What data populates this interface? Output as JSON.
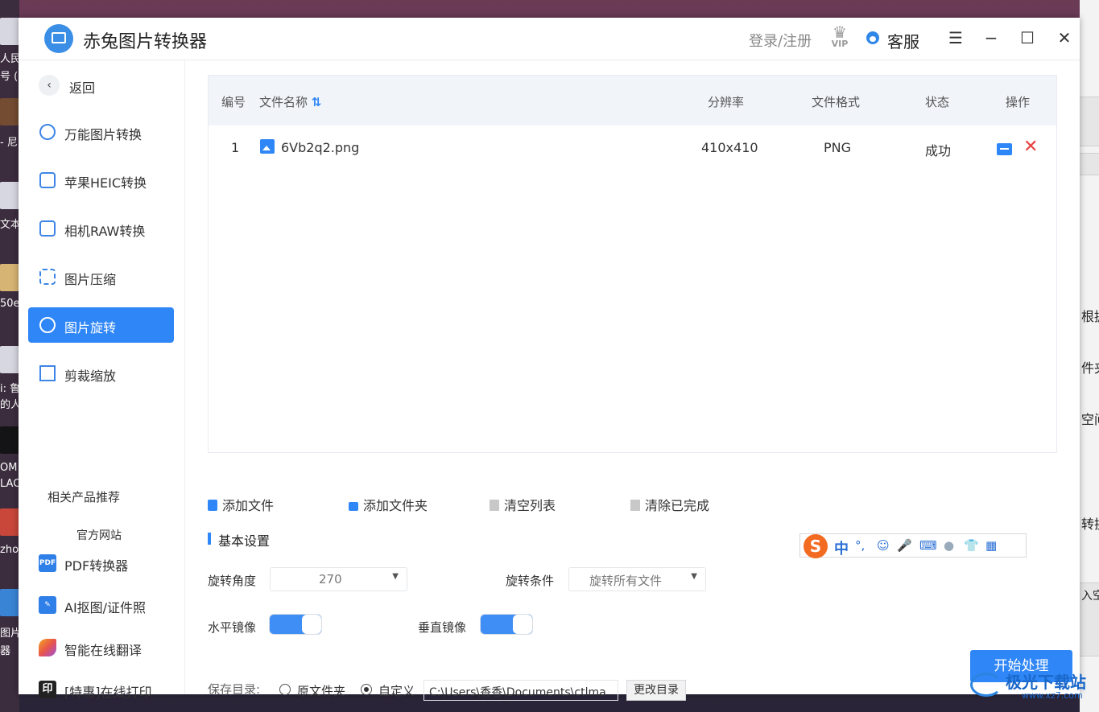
{
  "app": {
    "title": "赤兔图片转换器",
    "login": "登录/注册",
    "vip_badge": "VIP",
    "customer_service": "客服",
    "menu_icon": "menu-icon",
    "min_icon": "minimize-icon",
    "max_icon": "maximize-icon",
    "close_icon": "close-icon"
  },
  "sidebar": {
    "back": "返回",
    "items": [
      {
        "label": "万能图片转换",
        "icon": "image-convert-icon",
        "active": false
      },
      {
        "label": "苹果HEIC转换",
        "icon": "heic-icon",
        "active": false
      },
      {
        "label": "相机RAW转换",
        "icon": "raw-icon",
        "active": false
      },
      {
        "label": "图片压缩",
        "icon": "compress-icon",
        "active": false
      },
      {
        "label": "图片旋转",
        "icon": "rotate-icon",
        "active": true
      },
      {
        "label": "剪裁缩放",
        "icon": "crop-icon",
        "active": false
      }
    ],
    "related_title": "相关产品推荐",
    "official_site": "官方网站",
    "products": [
      {
        "label": "PDF转换器",
        "icon_text": "PDF",
        "color": "#2f7fe8"
      },
      {
        "label": "AI抠图/证件照",
        "icon_text": "✎",
        "color": "#2f7fe8"
      },
      {
        "label": "智能在线翻译",
        "icon_text": "",
        "color": "#e8544a"
      },
      {
        "label": "[特惠]在线打印",
        "icon_text": "印",
        "color": "#222222"
      }
    ]
  },
  "table": {
    "headers": {
      "index": "编号",
      "name": "文件名称",
      "sort_icon": "⇅",
      "resolution": "分辨率",
      "format": "文件格式",
      "status": "状态",
      "action": "操作"
    },
    "rows": [
      {
        "index": "1",
        "name": "6Vb2q2.png",
        "resolution": "410x410",
        "format": "PNG",
        "status": "成功"
      }
    ]
  },
  "actions": {
    "add_file": "添加文件",
    "add_folder": "添加文件夹",
    "clear_list": "清空列表",
    "clear_done": "清除已完成"
  },
  "settings": {
    "section_title": "基本设置",
    "rotate_angle_label": "旋转角度",
    "rotate_angle_value": "270",
    "rotate_condition_label": "旋转条件",
    "rotate_condition_value": "旋转所有文件",
    "h_mirror_label": "水平镜像",
    "h_mirror_on": true,
    "v_mirror_label": "垂直镜像",
    "v_mirror_on": true
  },
  "save": {
    "label": "保存目录:",
    "option_original": "原文件夹",
    "option_custom": "自定义",
    "selected": "custom",
    "path": "C:\\Users\\香香\\Documents\\ctlma",
    "change_dir": "更改目录"
  },
  "start_button": "开始处理",
  "ime": {
    "logo": "S",
    "mode": "中",
    "punct": "°,",
    "emoji": "☺",
    "mic": "🎤",
    "keyboard": "⌨",
    "skin": "👕",
    "apps": "▦"
  },
  "watermark": {
    "text": "极光下载站",
    "url": "www.xz7.com"
  },
  "desktop": {
    "left_texts": [
      "人民",
      "号 (扌",
      "- 尼",
      "文本",
      "50e",
      "i: 鲁",
      "的人",
      "OM",
      "LAC",
      "zho",
      "图片",
      "器"
    ],
    "right_texts": [
      "根据",
      "件夹",
      "空间",
      "转换",
      "入空"
    ]
  },
  "colors": {
    "accent": "#2f86f6",
    "danger": "#e84040",
    "header_bg": "#f1f5fa"
  }
}
